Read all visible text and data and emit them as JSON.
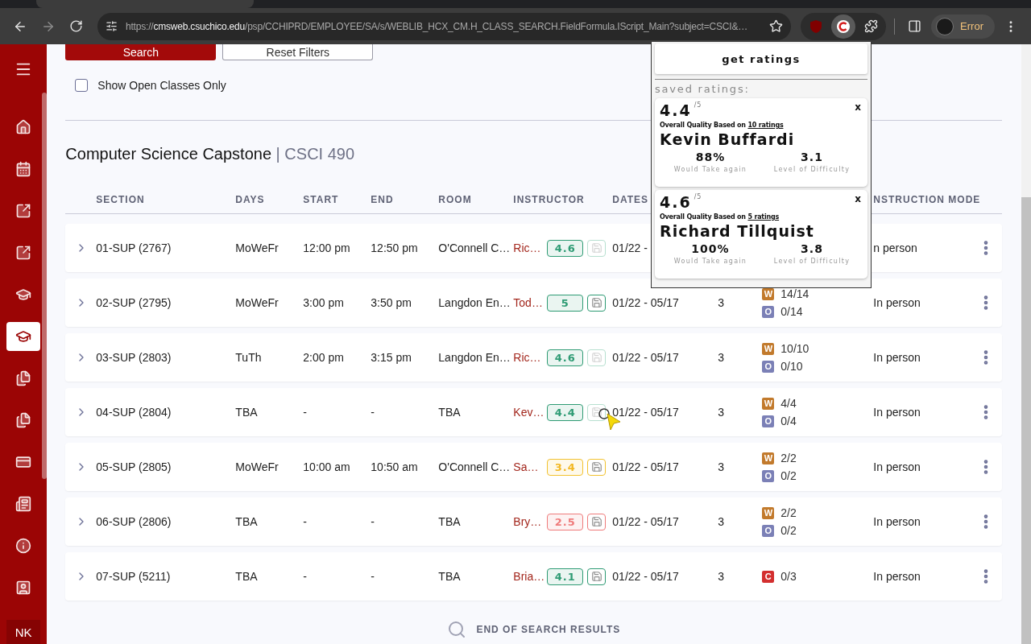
{
  "browser": {
    "url": {
      "scheme": "https://",
      "host": "cmsweb.csuchico.edu",
      "path": "/psp/CCHIPRD/EMPLOYEE/SA/s/WEBLIB_HCX_CM.H_CLASS_SEARCH.FieldFormula.IScript_Main?subject=CSCI&…"
    },
    "profile": {
      "label": "Error"
    }
  },
  "sidebar": {
    "items": [
      {
        "selected": false
      },
      {
        "selected": false
      },
      {
        "selected": false
      },
      {
        "selected": false
      },
      {
        "selected": false
      },
      {
        "selected": true
      },
      {
        "selected": false
      },
      {
        "selected": false
      },
      {
        "selected": false
      },
      {
        "selected": false
      },
      {
        "selected": false
      },
      {
        "selected": false
      }
    ],
    "avatar": {
      "initials": "NK"
    }
  },
  "filters": {
    "buttons": [
      "Search",
      "Reset Filters"
    ],
    "open_only": {
      "label": "Show Open Classes Only",
      "checked": false
    }
  },
  "course": {
    "title": "Computer Science Capstone",
    "code": "| CSCI 490"
  },
  "table": {
    "columns": [
      "SECTION",
      "DAYS",
      "START",
      "END",
      "ROOM",
      "INSTRUCTOR",
      "DATES",
      "NSTRUCTION MODE"
    ],
    "rows": [
      {
        "section": "01-SUP (2767)",
        "days": "MoWeFr",
        "start": "12:00 pm",
        "end": "12:50 pm",
        "room": "O'Connell C…",
        "instructor": "Ric…",
        "rating": {
          "value": "4.6",
          "color": "#2e9b74"
        },
        "saved": true,
        "dates": "01/22 -",
        "mode": "n person"
      },
      {
        "section": "02-SUP (2795)",
        "days": "MoWeFr",
        "start": "3:00 pm",
        "end": "3:50 pm",
        "room": "Langdon En…",
        "instructor": "Tod…",
        "rating": {
          "value": "5",
          "color": "#2e9b74"
        },
        "saved": false,
        "dates": "01/22 - 05/17",
        "units": "3",
        "seats": [
          {
            "badge": "W",
            "color": "#c27a2c",
            "count": "14/14"
          },
          {
            "badge": "O",
            "color": "#7b80b6",
            "count": "0/14"
          }
        ],
        "mode": "In person"
      },
      {
        "section": "03-SUP (2803)",
        "days": "TuTh",
        "start": "2:00 pm",
        "end": "3:15 pm",
        "room": "Langdon En…",
        "instructor": "Ric…",
        "rating": {
          "value": "4.6",
          "color": "#2e9b74"
        },
        "saved": true,
        "dates": "01/22 - 05/17",
        "units": "3",
        "seats": [
          {
            "badge": "W",
            "color": "#c27a2c",
            "count": "10/10"
          },
          {
            "badge": "O",
            "color": "#7b80b6",
            "count": "0/10"
          }
        ],
        "mode": "In person"
      },
      {
        "section": "04-SUP (2804)",
        "days": "TBA",
        "start": "-",
        "end": "-",
        "room": "TBA",
        "instructor": "Kev…",
        "rating": {
          "value": "4.4",
          "color": "#2e9b74"
        },
        "saved": true,
        "dates": "01/22 - 05/17",
        "units": "3",
        "seats": [
          {
            "badge": "W",
            "color": "#c27a2c",
            "count": "4/4"
          },
          {
            "badge": "O",
            "color": "#7b80b6",
            "count": "0/4"
          }
        ],
        "mode": "In person"
      },
      {
        "section": "05-SUP (2805)",
        "days": "MoWeFr",
        "start": "10:00 am",
        "end": "10:50 am",
        "room": "O'Connell C…",
        "instructor": "Sa…",
        "rating": {
          "value": "3.4",
          "color": "#f2c230"
        },
        "saved": false,
        "dates": "01/22 - 05/17",
        "units": "3",
        "seats": [
          {
            "badge": "W",
            "color": "#c27a2c",
            "count": "2/2"
          },
          {
            "badge": "O",
            "color": "#7b80b6",
            "count": "0/2"
          }
        ],
        "mode": "In person"
      },
      {
        "section": "06-SUP (2806)",
        "days": "TBA",
        "start": "-",
        "end": "-",
        "room": "TBA",
        "instructor": "Bry…",
        "rating": {
          "value": "2.5",
          "color": "#ef7b7b"
        },
        "saved": false,
        "dates": "01/22 - 05/17",
        "units": "3",
        "seats": [
          {
            "badge": "W",
            "color": "#c27a2c",
            "count": "2/2"
          },
          {
            "badge": "O",
            "color": "#7b80b6",
            "count": "0/2"
          }
        ],
        "mode": "In person"
      },
      {
        "section": "07-SUP (5211)",
        "days": "TBA",
        "start": "-",
        "end": "-",
        "room": "TBA",
        "instructor": "Bria…",
        "rating": {
          "value": "4.1",
          "color": "#2e9b74"
        },
        "saved": false,
        "dates": "01/22 - 05/17",
        "units": "3",
        "seats": [
          {
            "badge": "C",
            "color": "#d32f2f",
            "count": "0/3"
          }
        ],
        "mode": "In person"
      }
    ],
    "end_note": "END OF SEARCH RESULTS"
  },
  "ratings_popup": {
    "button": "get ratings",
    "saved_label": "saved ratings:",
    "cards": [
      {
        "score": "4.4",
        "out_of": "/5",
        "based_on": "Overall Quality Based on",
        "count": "10 ratings",
        "name": "Kevin Buffardi",
        "take_again": "88%",
        "take_again_label": "Would Take again",
        "difficulty": "3.1",
        "difficulty_label": "Level of Difficulty",
        "close": "x"
      },
      {
        "score": "4.6",
        "out_of": "/5",
        "based_on": "Overall Quality Based on",
        "count": "5 ratings",
        "name": "Richard Tillquist",
        "take_again": "100%",
        "take_again_label": "Would Take again",
        "difficulty": "3.8",
        "difficulty_label": "Level of Difficulty",
        "close": "x"
      }
    ]
  }
}
